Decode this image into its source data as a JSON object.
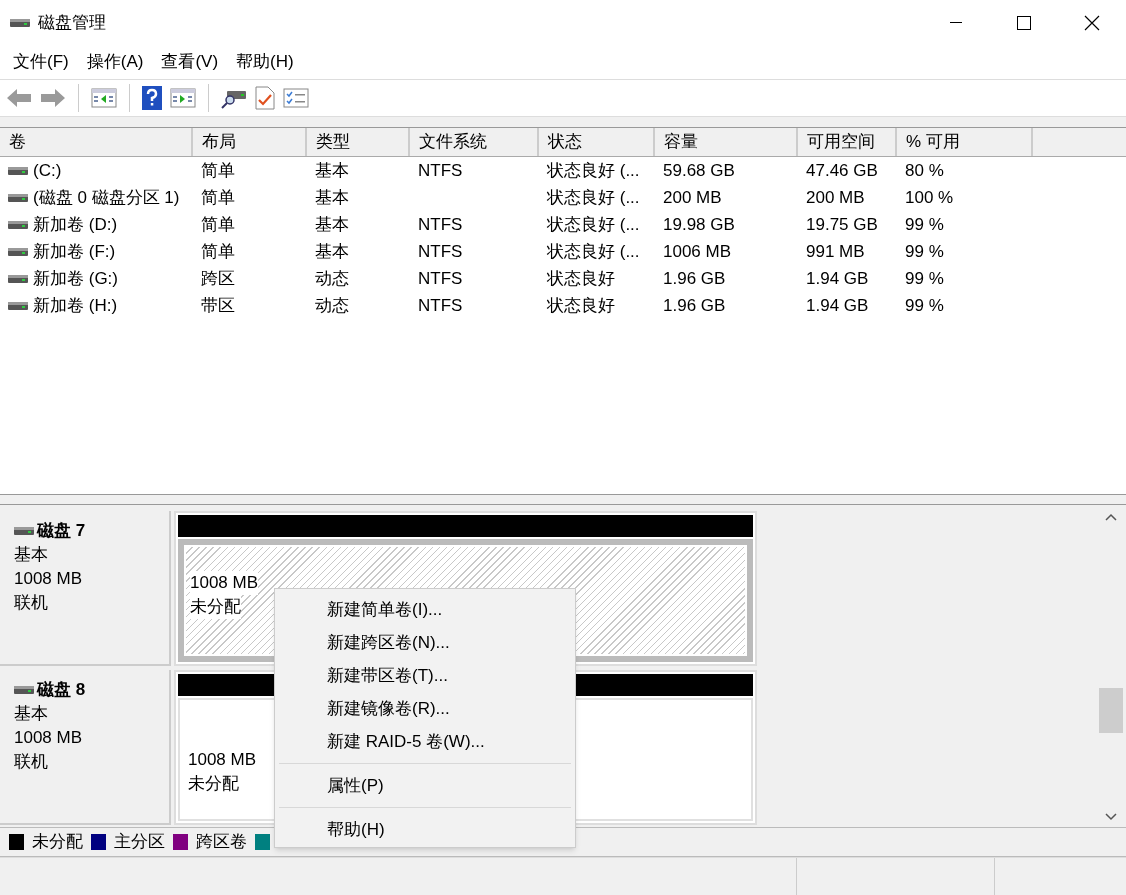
{
  "window": {
    "title": "磁盘管理"
  },
  "menu": [
    "文件(F)",
    "操作(A)",
    "查看(V)",
    "帮助(H)"
  ],
  "toolbar": [
    {
      "kind": "back",
      "disabled": true
    },
    {
      "kind": "forward",
      "disabled": true
    },
    {
      "kind": "sep"
    },
    {
      "kind": "pane-left"
    },
    {
      "kind": "sep"
    },
    {
      "kind": "help"
    },
    {
      "kind": "pane-right"
    },
    {
      "kind": "sep"
    },
    {
      "kind": "disk-search"
    },
    {
      "kind": "check-doc"
    },
    {
      "kind": "checklist"
    }
  ],
  "table": {
    "columns": [
      "卷",
      "布局",
      "类型",
      "文件系统",
      "状态",
      "容量",
      "可用空间",
      "% 可用"
    ],
    "rows": [
      [
        "(C:)",
        "简单",
        "基本",
        "NTFS",
        "状态良好 (...",
        "59.68 GB",
        "47.46 GB",
        "80 %"
      ],
      [
        "(磁盘 0 磁盘分区 1)",
        "简单",
        "基本",
        "",
        "状态良好 (...",
        "200 MB",
        "200 MB",
        "100 %"
      ],
      [
        "新加卷 (D:)",
        "简单",
        "基本",
        "NTFS",
        "状态良好 (...",
        "19.98 GB",
        "19.75 GB",
        "99 %"
      ],
      [
        "新加卷 (F:)",
        "简单",
        "基本",
        "NTFS",
        "状态良好 (...",
        "1006 MB",
        "991 MB",
        "99 %"
      ],
      [
        "新加卷 (G:)",
        "跨区",
        "动态",
        "NTFS",
        "状态良好",
        "1.96 GB",
        "1.94 GB",
        "99 %"
      ],
      [
        "新加卷 (H:)",
        "带区",
        "动态",
        "NTFS",
        "状态良好",
        "1.96 GB",
        "1.94 GB",
        "99 %"
      ]
    ]
  },
  "disks": [
    {
      "name": "磁盘 7",
      "type": "基本",
      "size": "1008 MB",
      "status": "联机",
      "partition": {
        "size": "1008 MB",
        "label": "未分配",
        "selected": true
      }
    },
    {
      "name": "磁盘 8",
      "type": "基本",
      "size": "1008 MB",
      "status": "联机",
      "partition": {
        "size": "1008 MB",
        "label": "未分配",
        "selected": false
      }
    }
  ],
  "legend": [
    {
      "label": "未分配",
      "color": "#000000"
    },
    {
      "label": "主分区",
      "color": "#000080"
    },
    {
      "label": "跨区卷",
      "color": "#800080"
    },
    {
      "color": "#008080"
    }
  ],
  "context_menu": [
    {
      "kind": "item",
      "label": "新建简单卷(I)..."
    },
    {
      "kind": "item",
      "label": "新建跨区卷(N)..."
    },
    {
      "kind": "item",
      "label": "新建带区卷(T)..."
    },
    {
      "kind": "item",
      "label": "新建镜像卷(R)..."
    },
    {
      "kind": "item",
      "label": "新建 RAID-5 卷(W)..."
    },
    {
      "kind": "separator"
    },
    {
      "kind": "item",
      "label": "属性(P)"
    },
    {
      "kind": "separator"
    },
    {
      "kind": "item",
      "label": "帮助(H)"
    }
  ]
}
